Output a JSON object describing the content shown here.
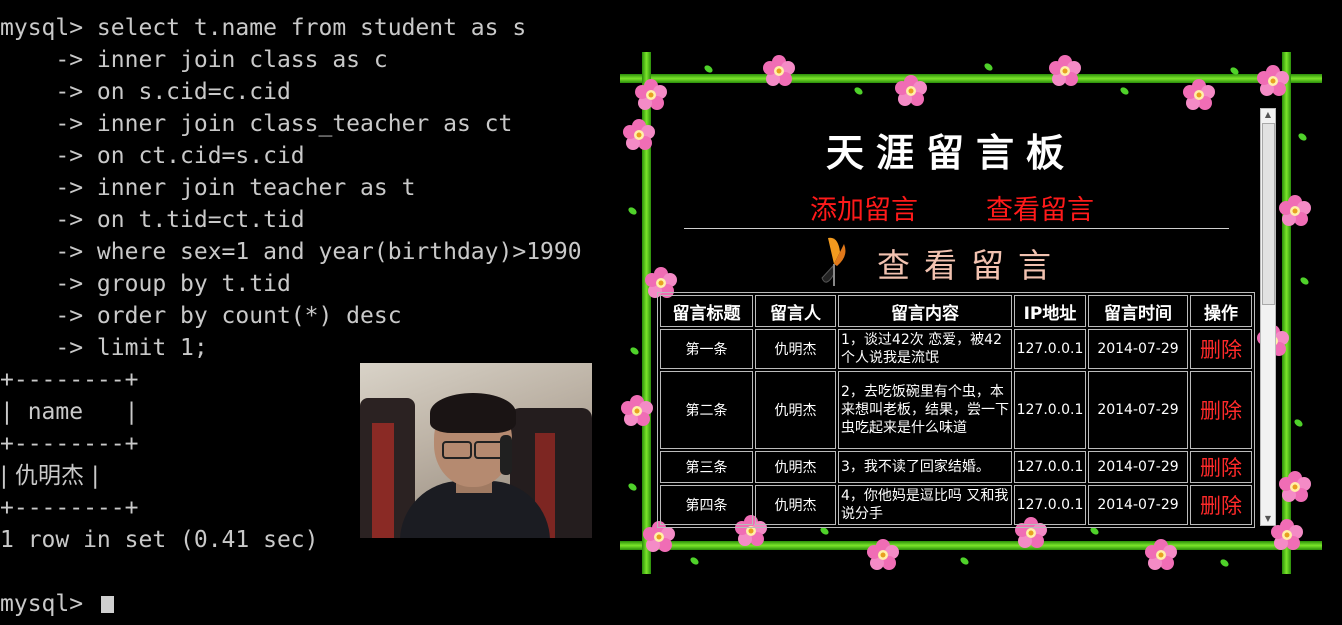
{
  "terminal": {
    "lines": [
      "mysql> select t.name from student as s",
      "    -> inner join class as c",
      "    -> on s.cid=c.cid",
      "    -> inner join class_teacher as ct",
      "    -> on ct.cid=s.cid",
      "    -> inner join teacher as t",
      "    -> on t.tid=ct.tid",
      "    -> where sex=1 and year(birthday)>1990",
      "    -> group by t.tid",
      "    -> order by count(*) desc",
      "    -> limit 1;",
      "+--------+",
      "| name   |",
      "+--------+",
      "| 仇明杰 |",
      "+--------+",
      "1 row in set (0.41 sec)",
      "",
      "mysql> "
    ]
  },
  "guestbook": {
    "title": "天涯留言板",
    "nav_add": "添加留言",
    "nav_view": "查看留言",
    "subtitle": "查看留言",
    "headers": [
      "留言标题",
      "留言人",
      "留言内容",
      "IP地址",
      "留言时间",
      "操作"
    ],
    "rows": [
      {
        "title": "第一条",
        "author": "仇明杰",
        "content": "1，谈过42次 恋爱，被42个人说我是流氓",
        "ip": "127.0.0.1",
        "time": "2014-07-29",
        "action": "删除"
      },
      {
        "title": "第二条",
        "author": "仇明杰",
        "content": "2，去吃饭碗里有个虫，本来想叫老板，结果，尝一下虫吃起来是什么味道",
        "ip": "127.0.0.1",
        "time": "2014-07-29",
        "action": "删除"
      },
      {
        "title": "第三条",
        "author": "仇明杰",
        "content": "3，我不读了回家结婚。",
        "ip": "127.0.0.1",
        "time": "2014-07-29",
        "action": "删除"
      },
      {
        "title": "第四条",
        "author": "仇明杰",
        "content": "4，你他妈是逗比吗 又和我说分手",
        "ip": "127.0.0.1",
        "time": "2014-07-29",
        "action": "删除"
      }
    ],
    "colors": {
      "accent": "#ff1a1a",
      "frame": "#5fd320",
      "flower": "#f57fc0"
    }
  }
}
